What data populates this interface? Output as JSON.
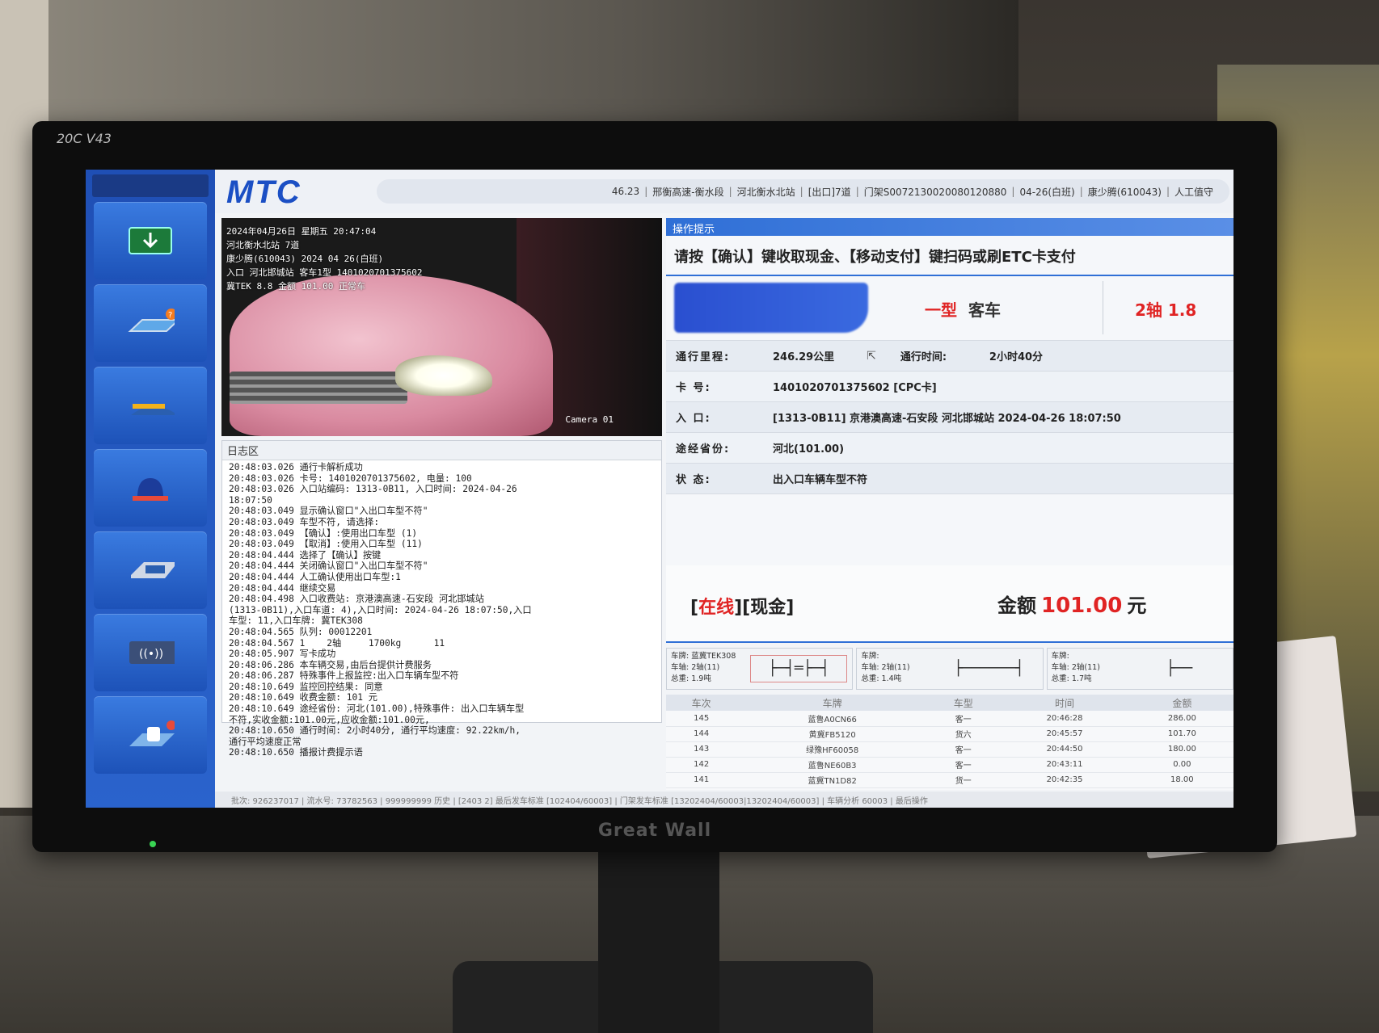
{
  "bezel": {
    "model": "20C V43",
    "brand": "Great Wall"
  },
  "header": {
    "logo": "MTC",
    "status": [
      "46.23",
      "邢衡高速-衡水段",
      "河北衡水北站",
      "[出口]7道",
      "门架S0072130020080120880",
      "04-26(白班)",
      "康少腾(610043)",
      "人工值守"
    ]
  },
  "sidebar": {
    "buttons": [
      {
        "icon": "download-arrow-icon"
      },
      {
        "icon": "card-question-icon"
      },
      {
        "icon": "toll-barrier-icon"
      },
      {
        "icon": "alarm-light-icon"
      },
      {
        "icon": "card-reader-icon"
      },
      {
        "icon": "wireless-pay-icon"
      },
      {
        "icon": "vehicle-queue-icon"
      }
    ]
  },
  "camera": {
    "overlay": [
      "2024年04月26日 星期五 20:47:04",
      "河北衡水北站 7道",
      "康少腾(610043) 2024 04 26(白班)",
      "入口 河北邯城站 客车1型 1401020701375602",
      "冀TEK 8.8 金额 101.00 正常车"
    ],
    "label": "Camera 01"
  },
  "log": {
    "title": "日志区",
    "lines": [
      "20:48:03.026 通行卡解析成功",
      "20:48:03.026 卡号: 1401020701375602, 电量: 100",
      "20:48:03.026 入口站编码: 1313-0B11, 入口时间: 2024-04-26",
      "18:07:50",
      "20:48:03.049 显示确认窗口\"入出口车型不符\"",
      "20:48:03.049 车型不符, 请选择:",
      "20:48:03.049 【确认】:使用出口车型 (1)",
      "20:48:03.049 【取消】:使用入口车型 (11)",
      "20:48:04.444 选择了【确认】按键",
      "20:48:04.444 关闭确认窗口\"入出口车型不符\"",
      "20:48:04.444 人工确认使用出口车型:1",
      "20:48:04.444 继续交易",
      "20:48:04.498 入口收费站: 京港澳高速-石安段 河北邯城站",
      "(1313-0B11),入口车道: 4),入口时间: 2024-04-26 18:07:50,入口",
      "车型: 11,入口车牌: 冀TEK308",
      "20:48:04.565 队列: 00012201",
      "20:48:04.567 1    2轴     1700kg      11",
      "20:48:05.907 写卡成功",
      "20:48:06.286 本车辆交易,由后台提供计费服务",
      "20:48:06.287 特殊事件上报监控:出入口车辆车型不符",
      "20:48:10.649 监控回控结果: 同意",
      "20:48:10.649 收费金额: 101 元",
      "20:48:10.649 途经省份: 河北(101.00),特殊事件: 出入口车辆车型",
      "不符,实收金额:101.00元,应收金额:101.00元,",
      "20:48:10.650 通行时间: 2小时40分, 通行平均速度: 92.22km/h,",
      "通行平均速度正常",
      "20:48:10.650 播报计费提示语"
    ]
  },
  "operation": {
    "title": "操作提示",
    "prompt": "请按【确认】键收取现金、【移动支付】键扫码或刷ETC卡支付",
    "vehicle_class": "一型",
    "vehicle_kind": "客车",
    "axle": "2轴  1.8",
    "rows": {
      "mileage_label": "通行里程:",
      "mileage": "246.29公里",
      "time_label": "通行时间:",
      "time": "2小时40分",
      "card_label": "卡    号:",
      "card": "1401020701375602 [CPC卡]",
      "entry_label": "入    口:",
      "entry": "[1313-0B11] 京港澳高速-石安段 河北邯城站 2024-04-26 18:07:50",
      "province_label": "途经省份:",
      "province": "河北(101.00)",
      "state_label": "状    态:",
      "state": "出入口车辆车型不符"
    },
    "pay": {
      "online": "在线",
      "cash": "现金",
      "amount_label": "金额",
      "amount": "101.00",
      "unit": "元"
    }
  },
  "axle_cards": [
    {
      "plate": "车牌: 蓝冀TEK308",
      "axles": "车轴: 2轴(11)",
      "weight": "总重: 1.9吨",
      "diagram": "├─┤═├─┤"
    },
    {
      "plate": "车牌:",
      "axles": "车轴: 2轴(11)",
      "weight": "总重: 1.4吨",
      "diagram": "├──────┤"
    },
    {
      "plate": "车牌:",
      "axles": "车轴: 2轴(11)",
      "weight": "总重: 1.7吨",
      "diagram": "├──"
    }
  ],
  "history": {
    "headers": [
      "车次",
      "车牌",
      "车型",
      "时间",
      "金额"
    ],
    "rows": [
      [
        "145",
        "蓝鲁A0CN66",
        "客一",
        "20:46:28",
        "286.00"
      ],
      [
        "144",
        "黄冀FB5120",
        "货六",
        "20:45:57",
        "101.70"
      ],
      [
        "143",
        "绿豫HF60058",
        "客一",
        "20:44:50",
        "180.00"
      ],
      [
        "142",
        "蓝鲁NE60B3",
        "客一",
        "20:43:11",
        "0.00"
      ],
      [
        "141",
        "蓝冀TN1D82",
        "货一",
        "20:42:35",
        "18.00"
      ]
    ]
  },
  "footer": "批次: 926237017 | 流水号: 73782563 | 999999999 历史 | [2403 2] 最后发车标准 [102404/60003] | 门架发车标准 [13202404/60003|13202404/60003] | 车辆分析 60003 | 最后操作"
}
